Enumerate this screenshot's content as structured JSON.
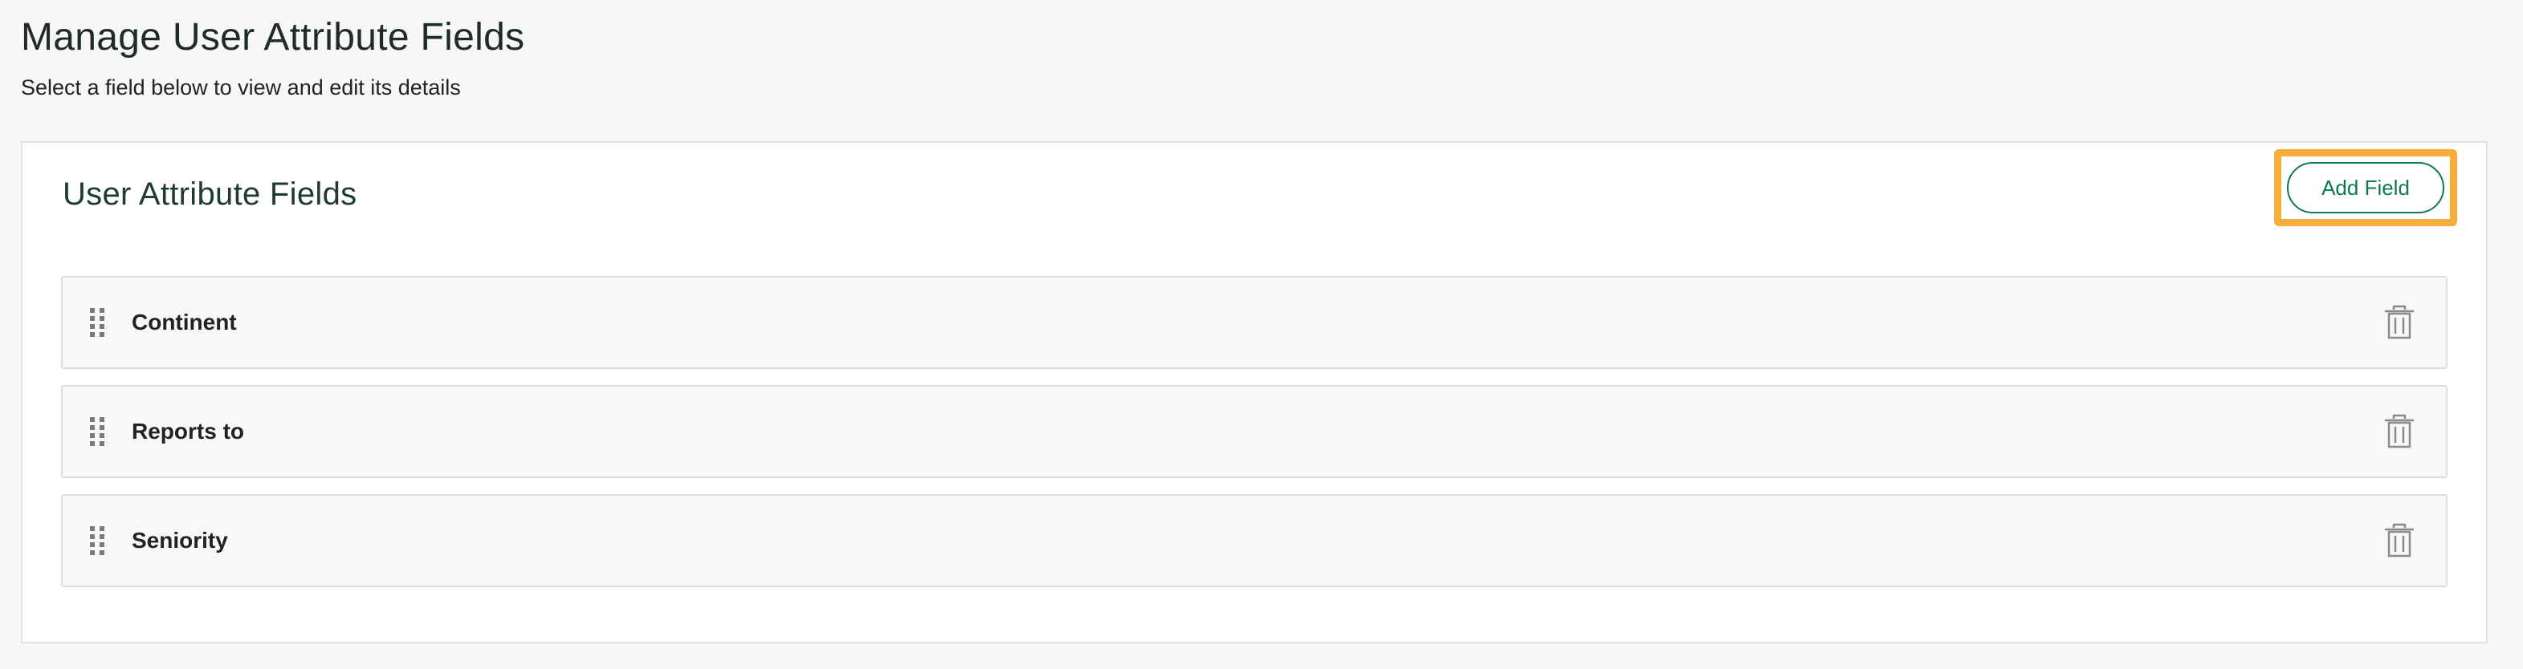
{
  "page": {
    "title": "Manage User Attribute Fields",
    "subtitle": "Select a field below to view and edit its details"
  },
  "panel": {
    "title": "User Attribute Fields",
    "add_button_label": "Add Field"
  },
  "fields": [
    {
      "label": "Continent",
      "drag_icon": "drag-handle-icon",
      "delete_icon": "trash-icon"
    },
    {
      "label": "Reports to",
      "drag_icon": "drag-handle-icon",
      "delete_icon": "trash-icon"
    },
    {
      "label": "Seniority",
      "drag_icon": "drag-handle-icon",
      "delete_icon": "trash-icon"
    }
  ],
  "colors": {
    "accent_green": "#0b7a55",
    "highlight_orange": "#f7ad3b",
    "background": "#f7f7f7",
    "panel_background": "#ffffff",
    "row_background": "#f8f8f8"
  }
}
